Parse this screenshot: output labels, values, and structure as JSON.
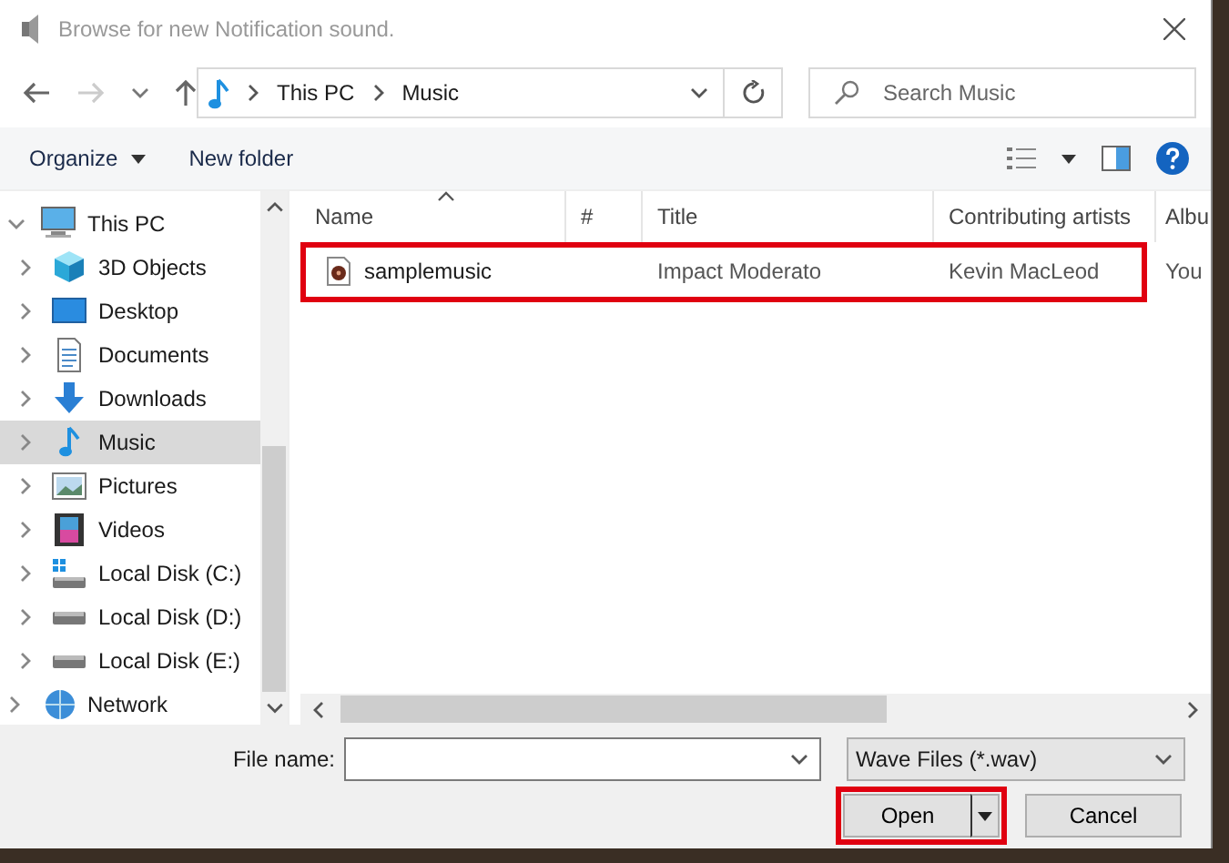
{
  "window": {
    "title": "Browse for new Notification sound."
  },
  "address": {
    "crumbs": [
      "This PC",
      "Music"
    ]
  },
  "search": {
    "placeholder": "Search Music"
  },
  "toolbar": {
    "organize": "Organize",
    "new_folder": "New folder"
  },
  "sidebar": {
    "items": [
      {
        "label": "This PC",
        "kind": "pc",
        "expanded": true,
        "selected": false,
        "children": [
          {
            "label": "3D Objects",
            "kind": "cube",
            "expanded": false,
            "selected": false
          },
          {
            "label": "Desktop",
            "kind": "desktop",
            "expanded": false,
            "selected": false
          },
          {
            "label": "Documents",
            "kind": "doc",
            "expanded": false,
            "selected": false
          },
          {
            "label": "Downloads",
            "kind": "down",
            "expanded": false,
            "selected": false
          },
          {
            "label": "Music",
            "kind": "music",
            "expanded": false,
            "selected": true
          },
          {
            "label": "Pictures",
            "kind": "pic",
            "expanded": false,
            "selected": false
          },
          {
            "label": "Videos",
            "kind": "video",
            "expanded": false,
            "selected": false
          },
          {
            "label": "Local Disk (C:)",
            "kind": "sysdisk",
            "expanded": false,
            "selected": false
          },
          {
            "label": "Local Disk (D:)",
            "kind": "disk",
            "expanded": false,
            "selected": false
          },
          {
            "label": "Local Disk (E:)",
            "kind": "disk",
            "expanded": false,
            "selected": false
          }
        ]
      },
      {
        "label": "Network",
        "kind": "net",
        "expanded": false,
        "selected": false
      }
    ]
  },
  "table": {
    "columns": [
      "Name",
      "#",
      "Title",
      "Contributing artists",
      "Albu"
    ],
    "rows": [
      {
        "cells": [
          "samplemusic",
          "",
          "Impact Moderato",
          "Kevin MacLeod",
          "You"
        ],
        "highlighted": true
      }
    ]
  },
  "footer": {
    "file_name_label": "File name:",
    "file_type": "Wave Files (*.wav)",
    "open": {
      "label": "Open",
      "highlighted": true
    },
    "cancel": "Cancel"
  }
}
